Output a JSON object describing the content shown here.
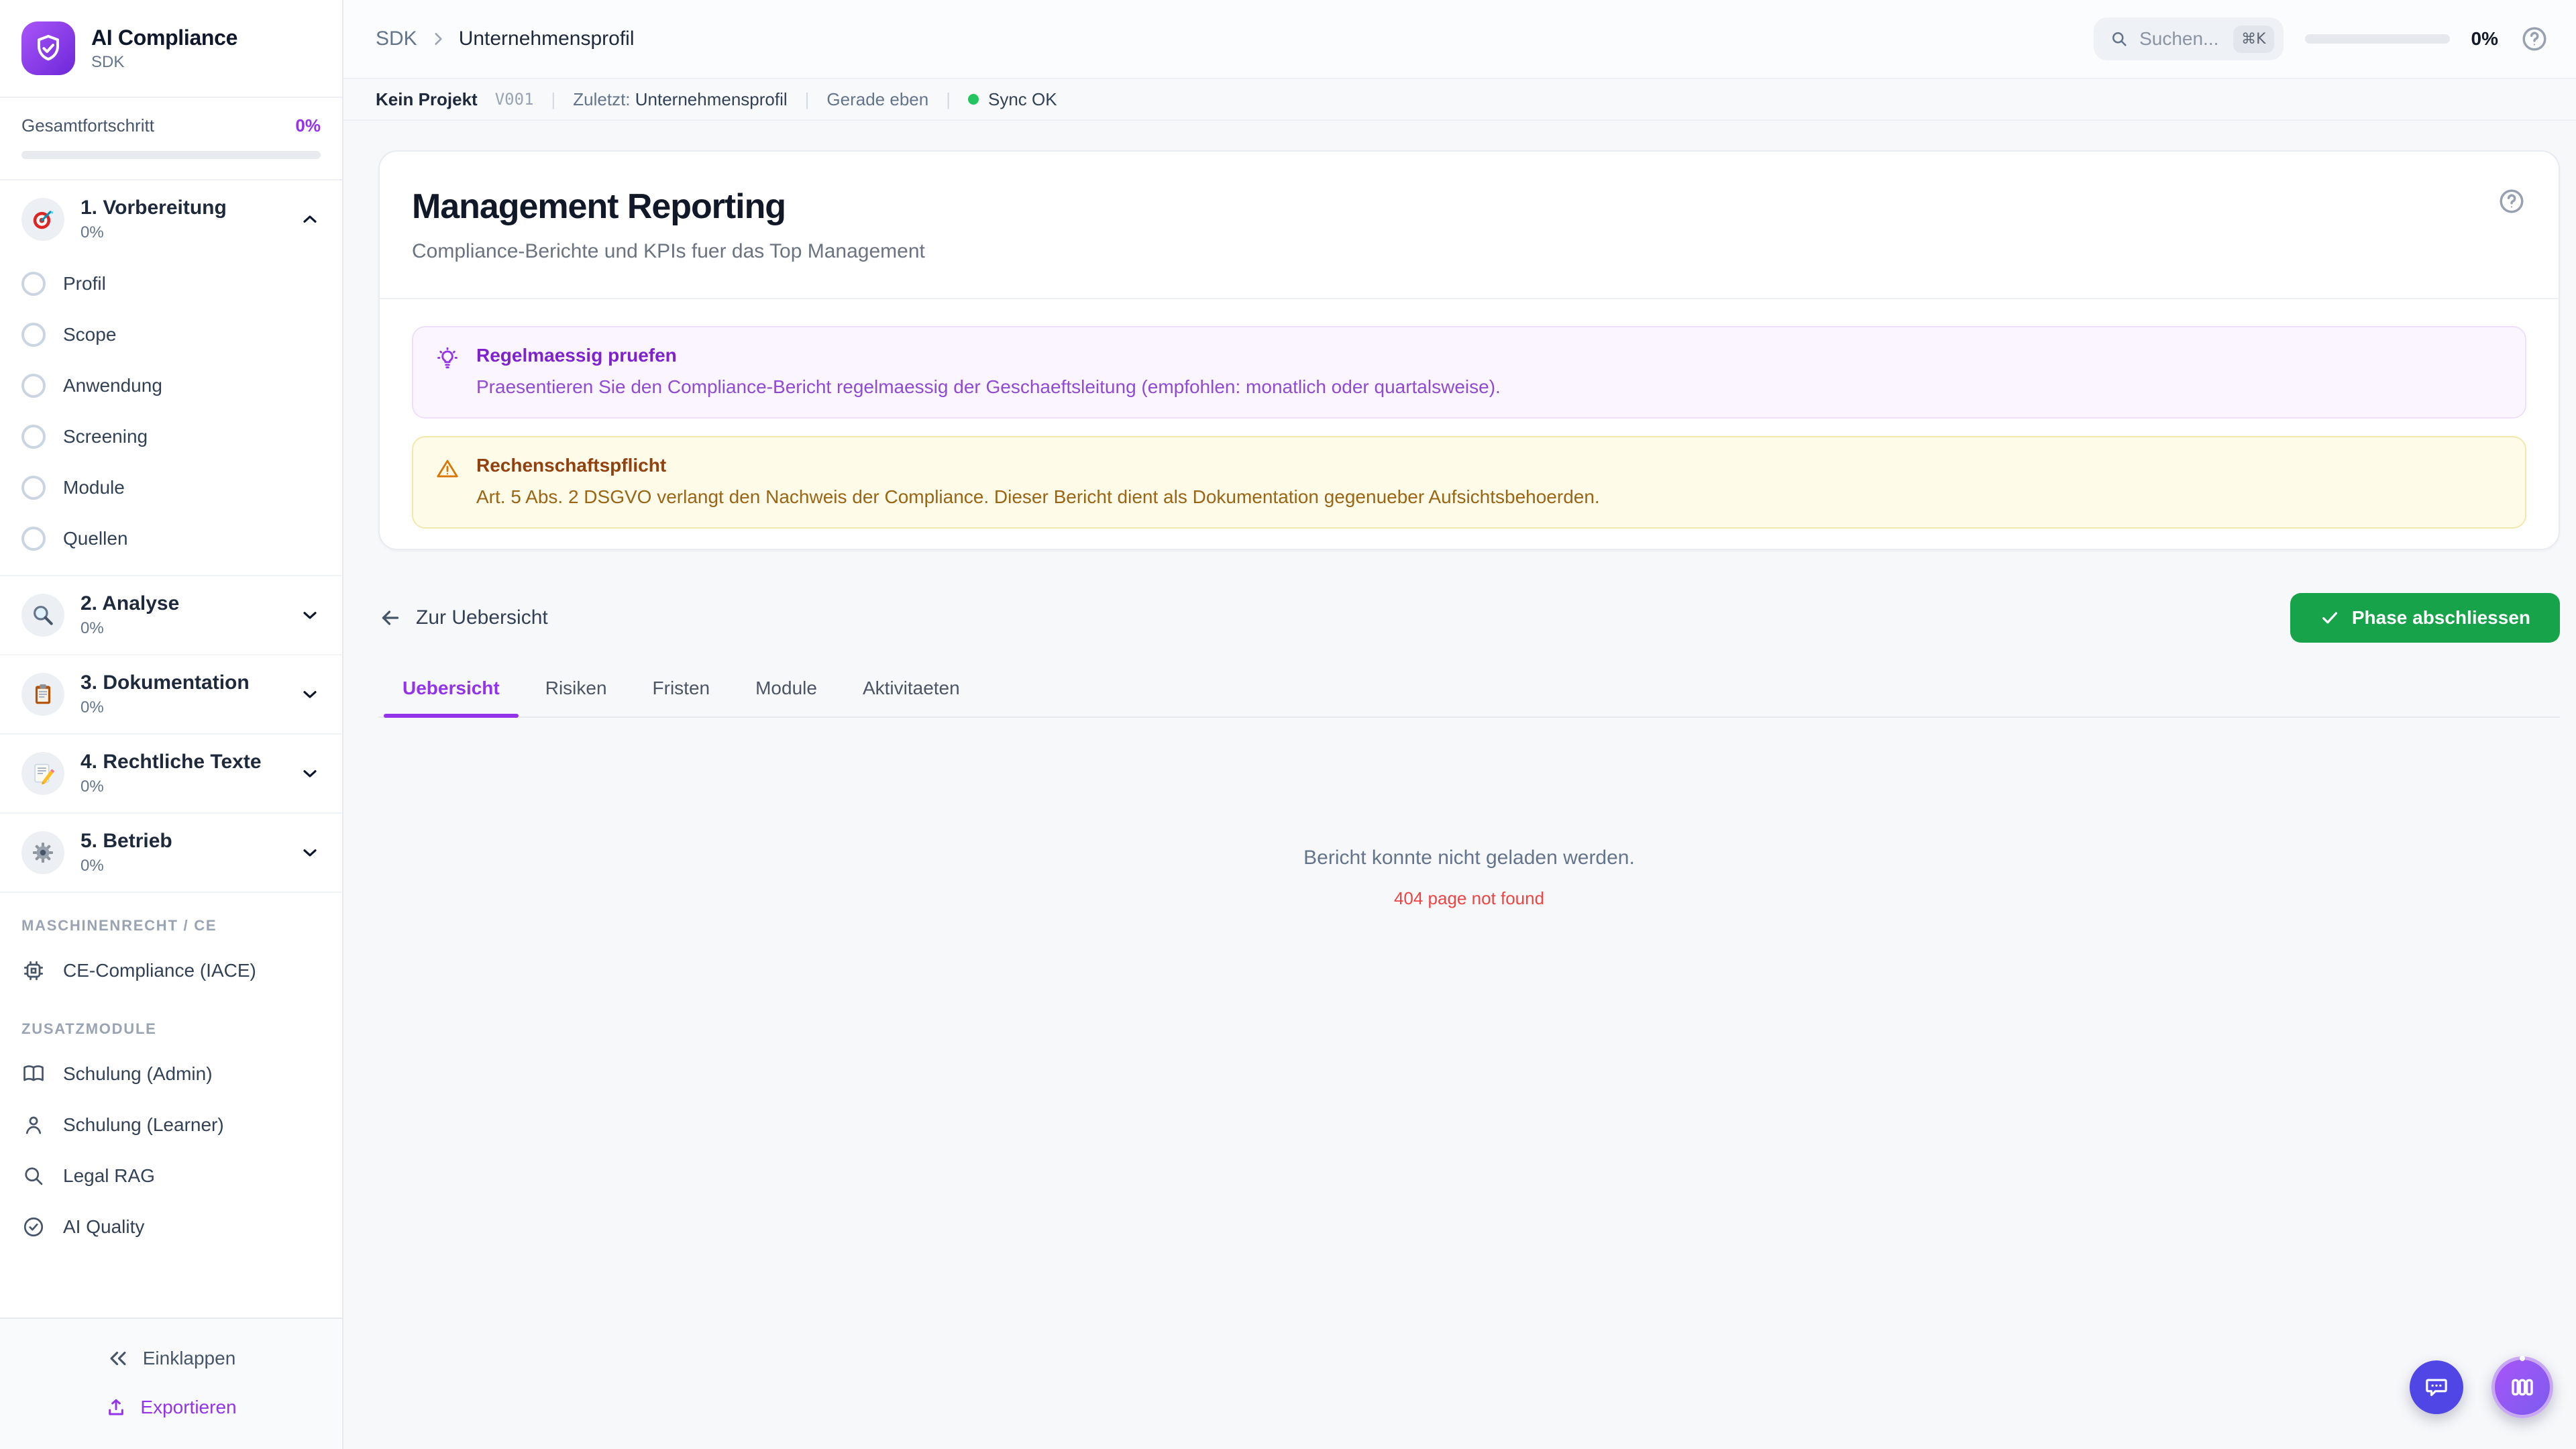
{
  "app": {
    "name": "AI Compliance",
    "subtitle": "SDK"
  },
  "sidebar": {
    "progress": {
      "label": "Gesamtfortschritt",
      "value": "0%"
    },
    "phases": [
      {
        "icon": "target-icon",
        "label": "1. Vorbereitung",
        "percent": "0%",
        "expanded": true,
        "items": [
          "Profil",
          "Scope",
          "Anwendung",
          "Screening",
          "Module",
          "Quellen"
        ]
      },
      {
        "icon": "magnifier-icon",
        "label": "2. Analyse",
        "percent": "0%"
      },
      {
        "icon": "clipboard-icon",
        "label": "3. Dokumentation",
        "percent": "0%"
      },
      {
        "icon": "memo-icon",
        "label": "4. Rechtliche Texte",
        "percent": "0%"
      },
      {
        "icon": "gear-icon",
        "label": "5. Betrieb",
        "percent": "0%"
      }
    ],
    "sections": [
      {
        "label": "MASCHINENRECHT / CE",
        "items": [
          {
            "icon": "chip-icon",
            "label": "CE-Compliance (IACE)"
          }
        ]
      },
      {
        "label": "ZUSATZMODULE",
        "items": [
          {
            "icon": "book-icon",
            "label": "Schulung (Admin)"
          },
          {
            "icon": "user-icon",
            "label": "Schulung (Learner)"
          },
          {
            "icon": "search-icon",
            "label": "Legal RAG"
          },
          {
            "icon": "check-circle-icon",
            "label": "AI Quality"
          }
        ]
      }
    ],
    "footer": {
      "collapse": "Einklappen",
      "export": "Exportieren"
    }
  },
  "topbar": {
    "breadcrumb": {
      "root": "SDK",
      "current": "Unternehmensprofil"
    },
    "search": {
      "placeholder": "Suchen...",
      "shortcut": "⌘K"
    },
    "progress": {
      "value": "0%"
    }
  },
  "statusbar": {
    "project": "Kein Projekt",
    "version": "V001",
    "last_label": "Zuletzt:",
    "last_value": "Unternehmensprofil",
    "time": "Gerade eben",
    "sync": "Sync OK"
  },
  "page": {
    "title": "Management Reporting",
    "subtitle": "Compliance-Berichte und KPIs fuer das Top Management",
    "tip": {
      "title": "Regelmaessig pruefen",
      "body": "Praesentieren Sie den Compliance-Bericht regelmaessig der Geschaeftsleitung (empfohlen: monatlich oder quartalsweise)."
    },
    "warning": {
      "title": "Rechenschaftspflicht",
      "body": "Art. 5 Abs. 2 DSGVO verlangt den Nachweis der Compliance. Dieser Bericht dient als Dokumentation gegenueber Aufsichtsbehoerden."
    },
    "back_label": "Zur Uebersicht",
    "complete_label": "Phase abschliessen",
    "tabs": [
      "Uebersicht",
      "Risiken",
      "Fristen",
      "Module",
      "Aktivitaeten"
    ],
    "active_tab": "Uebersicht",
    "error": {
      "message": "Bericht konnte nicht geladen werden.",
      "detail": "404 page not found"
    }
  },
  "colors": {
    "accent": "#9333ea",
    "success": "#16a34a",
    "error": "#ef4444",
    "sync": "#22c55e",
    "fab_indigo": "#4f46e5",
    "tip_bg": "#faf5ff",
    "warn_bg": "#fefce8"
  }
}
